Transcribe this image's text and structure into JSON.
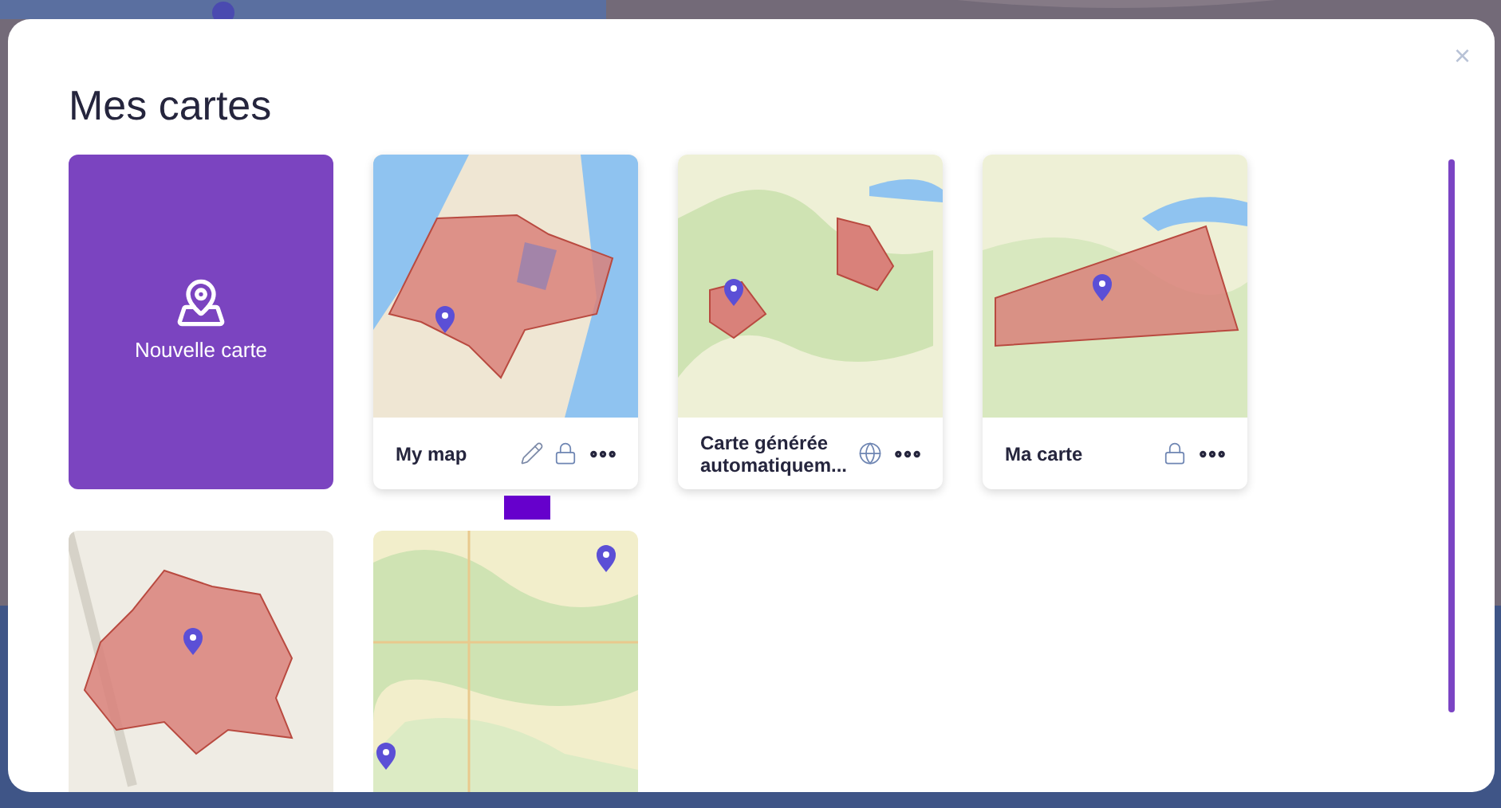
{
  "dialog": {
    "title": "Mes cartes",
    "close": "×"
  },
  "new_map": {
    "label": "Nouvelle carte"
  },
  "maps": [
    {
      "name": "My map",
      "editable": true,
      "locked": true,
      "shared": false
    },
    {
      "name": "Carte générée automatiquem...",
      "editable": false,
      "locked": false,
      "shared": true
    },
    {
      "name": "Ma carte",
      "editable": false,
      "locked": true,
      "shared": false
    },
    {
      "kind": "picture"
    },
    {
      "kind": "picture"
    }
  ]
}
